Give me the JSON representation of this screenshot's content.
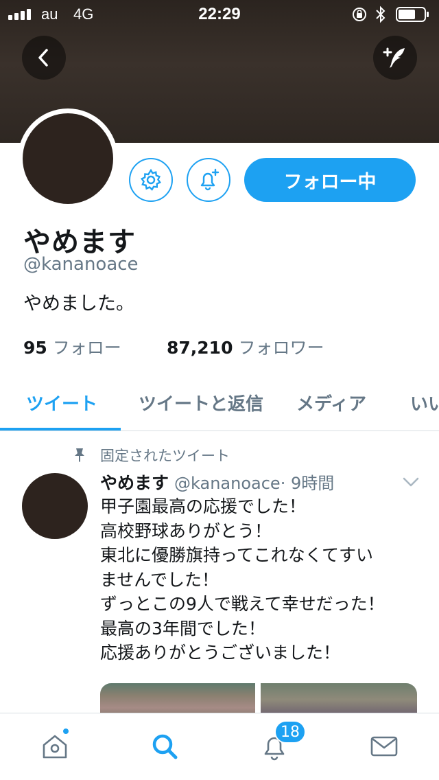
{
  "status_bar": {
    "carrier": "au",
    "network": "4G",
    "time": "22:29",
    "battery_level": 0.6
  },
  "profile": {
    "display_name": "やめます",
    "handle": "@kananoace",
    "bio": "やめました。",
    "following_count": "95",
    "following_label": "フォロー",
    "followers_count": "87,210",
    "followers_label": "フォロワー",
    "follow_button_label": "フォロー中"
  },
  "tabs": [
    {
      "label": "ツイート",
      "active": true
    },
    {
      "label": "ツイートと返信",
      "active": false
    },
    {
      "label": "メディア",
      "active": false
    },
    {
      "label": "いいね",
      "active": false
    }
  ],
  "pinned_tweet": {
    "pinned_label": "固定されたツイート",
    "author_name": "やめます",
    "author_handle": "@kananoace",
    "time": "· 9時間",
    "lines": [
      "甲子園最高の応援でした！",
      "高校野球ありがとう！",
      "東北に優勝旗持ってこれなくてすい",
      "ませんでした！",
      "ずっとこの9人で戦えて幸せだった！",
      "最高の3年間でした！",
      "応援ありがとうございました！"
    ]
  },
  "bottom_nav": {
    "notification_badge": "18",
    "items": [
      "home-icon",
      "search-icon",
      "bell-icon",
      "mail-icon"
    ]
  },
  "colors": {
    "accent": "#1da1f2",
    "text_primary": "#14171a",
    "text_secondary": "#657786"
  }
}
